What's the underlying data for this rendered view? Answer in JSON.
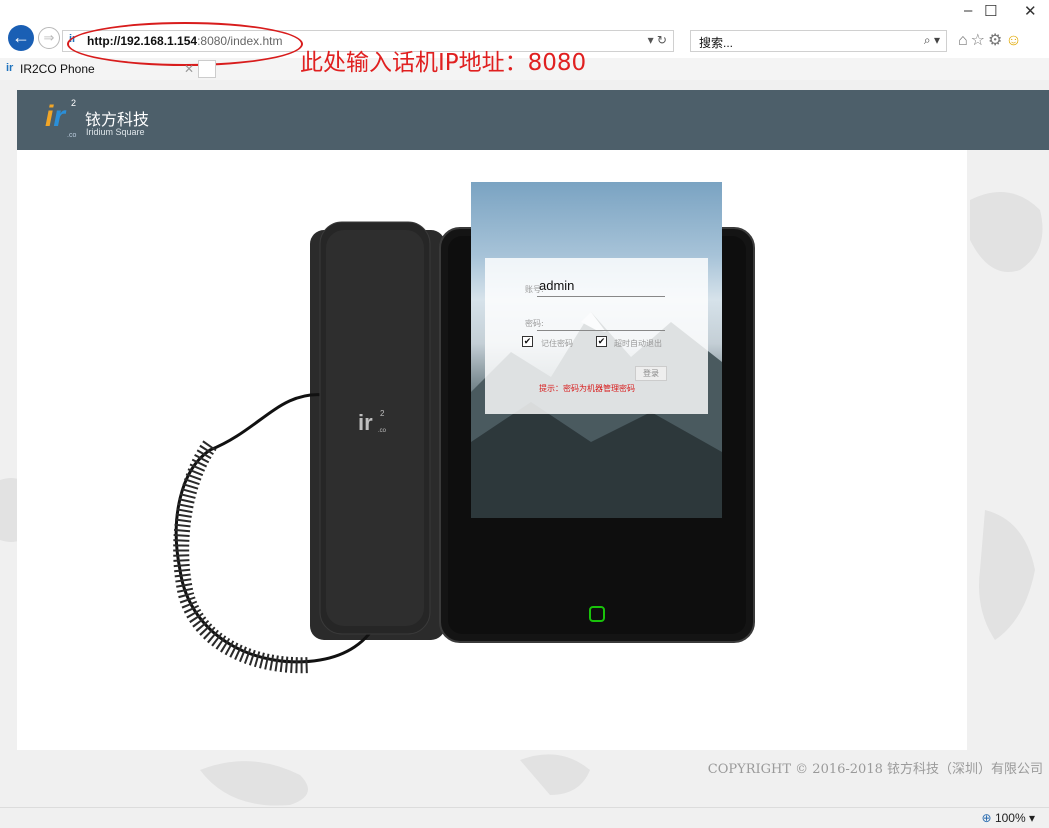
{
  "browser": {
    "url_host": "http://192.168.1.154",
    "url_rest": ":8080/index.htm",
    "search_placeholder": "搜索...",
    "tab_title": "IR2CO Phone",
    "annotation": "此处输入话机IP地址：8080",
    "zoom": "100%"
  },
  "site": {
    "brand_cn": "铱方科技",
    "brand_en": "Iridium Square",
    "copyright": "COPYRIGHT © 2016-2018 铱方科技（深圳）有限公司"
  },
  "login": {
    "account_label": "账号:",
    "account_value": "admin",
    "password_label": "密码:",
    "remember_label": "记住密码",
    "remember_checked": true,
    "autologout_label": "超时自动退出",
    "autologout_checked": true,
    "login_button": "登录",
    "tip": "提示：密码为机器管理密码"
  },
  "colors": {
    "header": "#4d5f6a",
    "annotation": "#e02020",
    "home_button": "#19c20a"
  },
  "icons": [
    "back-icon",
    "forward-icon",
    "refresh-icon",
    "search-icon",
    "home-icon",
    "favorites-icon",
    "settings-icon",
    "feedback-icon",
    "zoom-icon"
  ]
}
